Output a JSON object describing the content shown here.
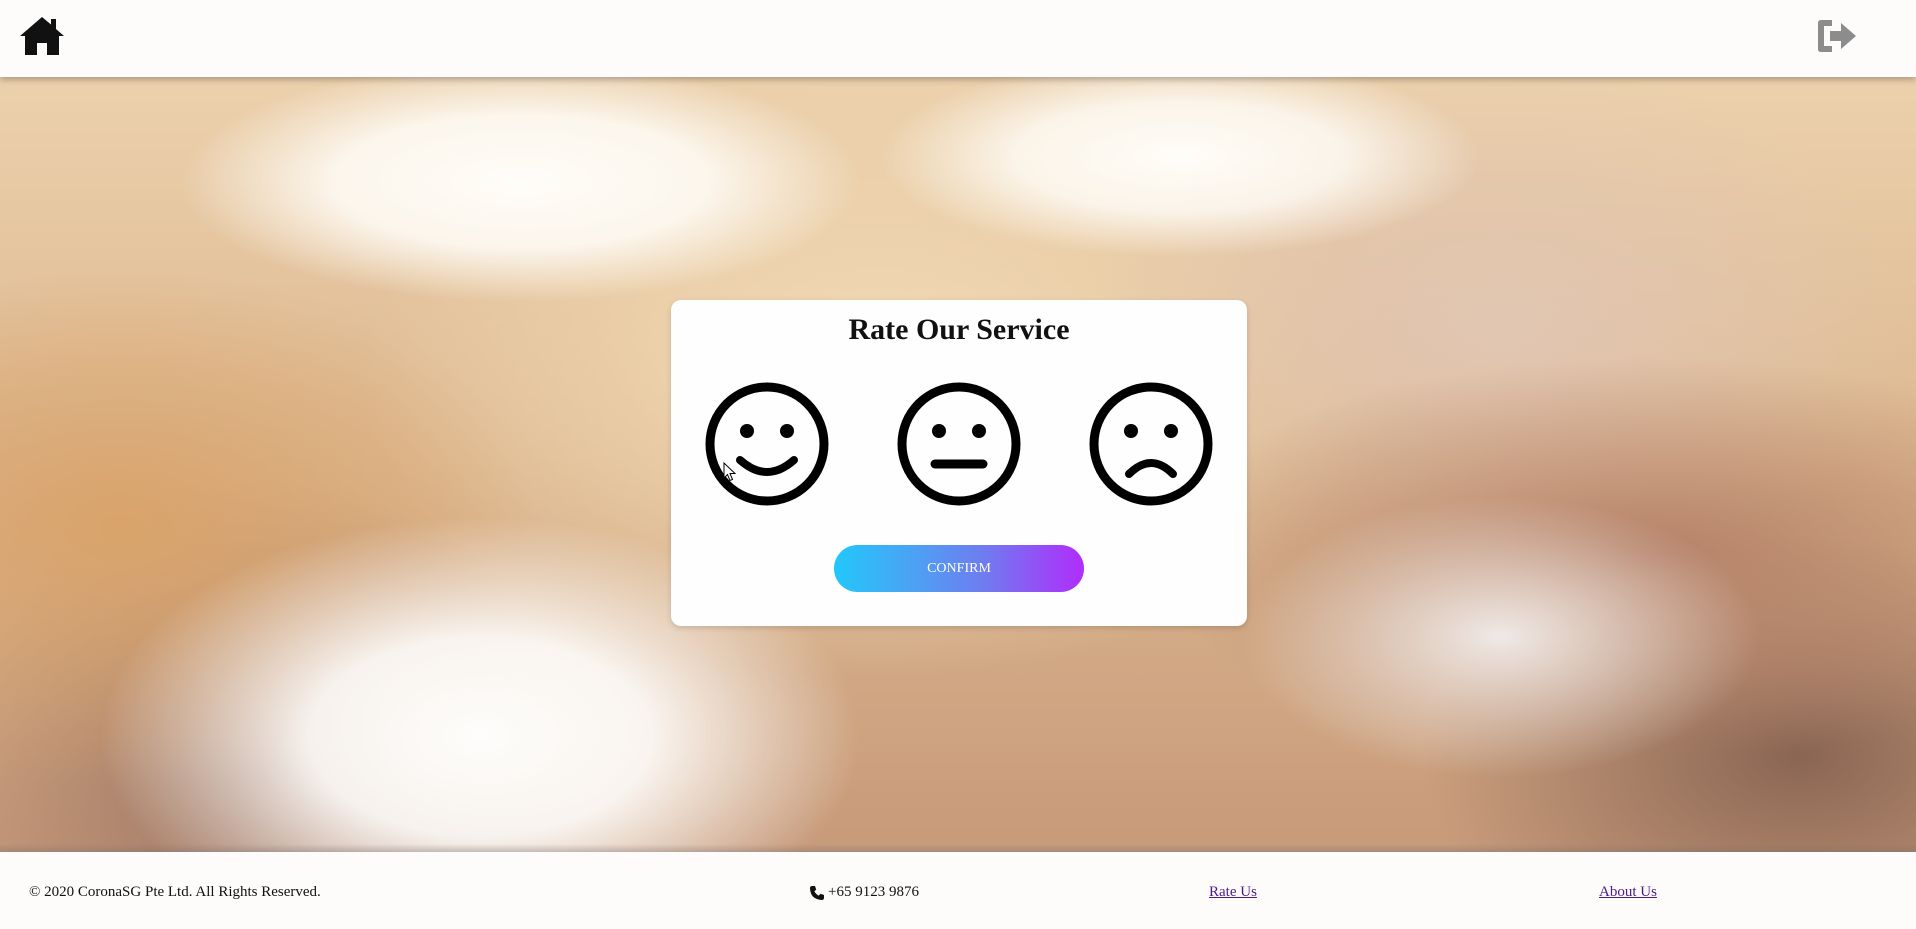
{
  "header": {
    "home_icon": "home-icon",
    "logout_icon": "sign-out-icon"
  },
  "rating_card": {
    "title": "Rate Our Service",
    "options": [
      {
        "name": "happy",
        "icon": "smile-face-icon"
      },
      {
        "name": "neutral",
        "icon": "neutral-face-icon"
      },
      {
        "name": "sad",
        "icon": "sad-face-icon"
      }
    ],
    "confirm_label": "CONFIRM"
  },
  "footer": {
    "copyright": "© 2020 CoronaSG Pte Ltd. All Rights Reserved.",
    "phone_icon": "phone-icon",
    "phone": "+65 9123 9876",
    "rate_link": "Rate Us",
    "about_link": "About Us"
  },
  "colors": {
    "button_gradient_start": "#22c7fb",
    "button_gradient_end": "#b12dfc",
    "link": "#4b1a8a",
    "logout_icon": "#8c8c8c"
  }
}
